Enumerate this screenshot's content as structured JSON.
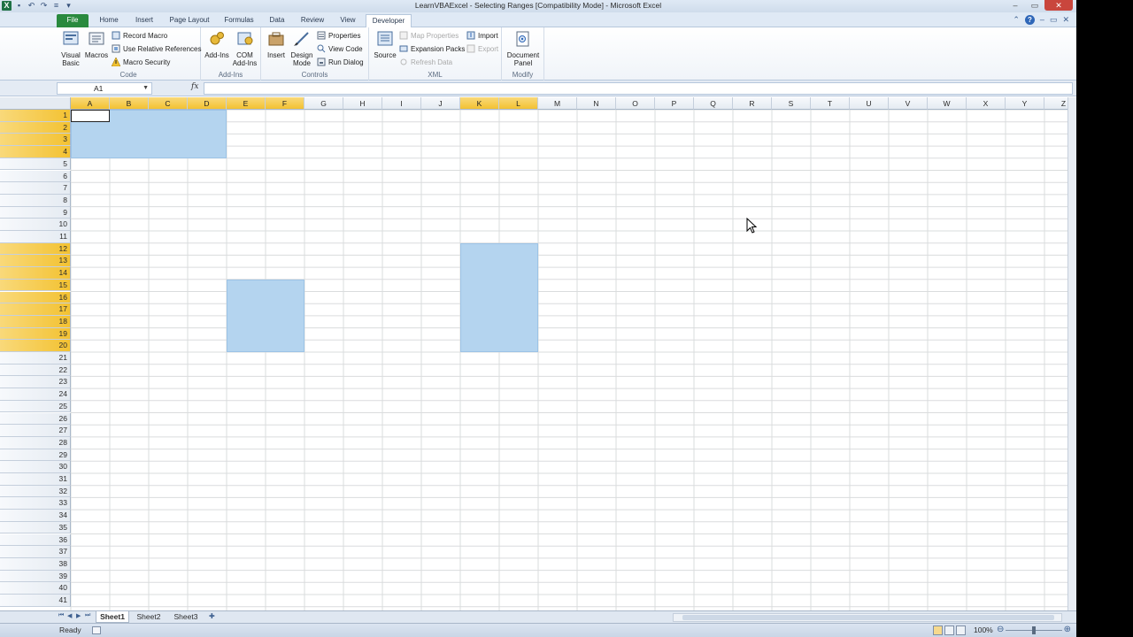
{
  "window": {
    "title": "LearnVBAExcel - Selecting Ranges  [Compatibility Mode]  -  Microsoft Excel"
  },
  "tabs": [
    "File",
    "Home",
    "Insert",
    "Page Layout",
    "Formulas",
    "Data",
    "Review",
    "View",
    "Developer"
  ],
  "active_tab": "Developer",
  "ribbon": {
    "code": {
      "label": "Code",
      "visual_basic": "Visual Basic",
      "macros": "Macros",
      "record_macro": "Record Macro",
      "use_relative_references": "Use Relative References",
      "macro_security": "Macro Security"
    },
    "addins": {
      "label": "Add-Ins",
      "addins": "Add-Ins",
      "com_addins": "COM Add-Ins"
    },
    "controls": {
      "label": "Controls",
      "insert": "Insert",
      "design_mode": "Design Mode",
      "properties": "Properties",
      "view_code": "View Code",
      "run_dialog": "Run Dialog"
    },
    "xml": {
      "label": "XML",
      "source": "Source",
      "map_properties": "Map Properties",
      "expansion_packs": "Expansion Packs",
      "refresh_data": "Refresh Data",
      "import": "Import",
      "export": "Export"
    },
    "modify": {
      "label": "Modify",
      "document_panel": "Document Panel"
    }
  },
  "formula_bar": {
    "name_box": "A1",
    "fx": "fx",
    "formula": ""
  },
  "grid": {
    "columns": [
      "A",
      "B",
      "C",
      "D",
      "E",
      "F",
      "G",
      "H",
      "I",
      "J",
      "K",
      "L",
      "M",
      "N",
      "O",
      "P",
      "Q",
      "R",
      "S",
      "T",
      "U",
      "V",
      "W",
      "X",
      "Y",
      "Z"
    ],
    "row_count": 41,
    "selected_columns": [
      "A",
      "B",
      "C",
      "D",
      "E",
      "F",
      "K",
      "L"
    ],
    "selected_rows": [
      1,
      2,
      3,
      4,
      12,
      13,
      14,
      15,
      16,
      17,
      18,
      19,
      20
    ],
    "selections": [
      {
        "range": "A1:D4"
      },
      {
        "range": "E15:F20"
      },
      {
        "range": "K12:L20"
      }
    ],
    "active_cell": "A1"
  },
  "sheets": [
    "Sheet1",
    "Sheet2",
    "Sheet3"
  ],
  "active_sheet": "Sheet1",
  "status": {
    "text": "Ready",
    "zoom": "100%"
  }
}
